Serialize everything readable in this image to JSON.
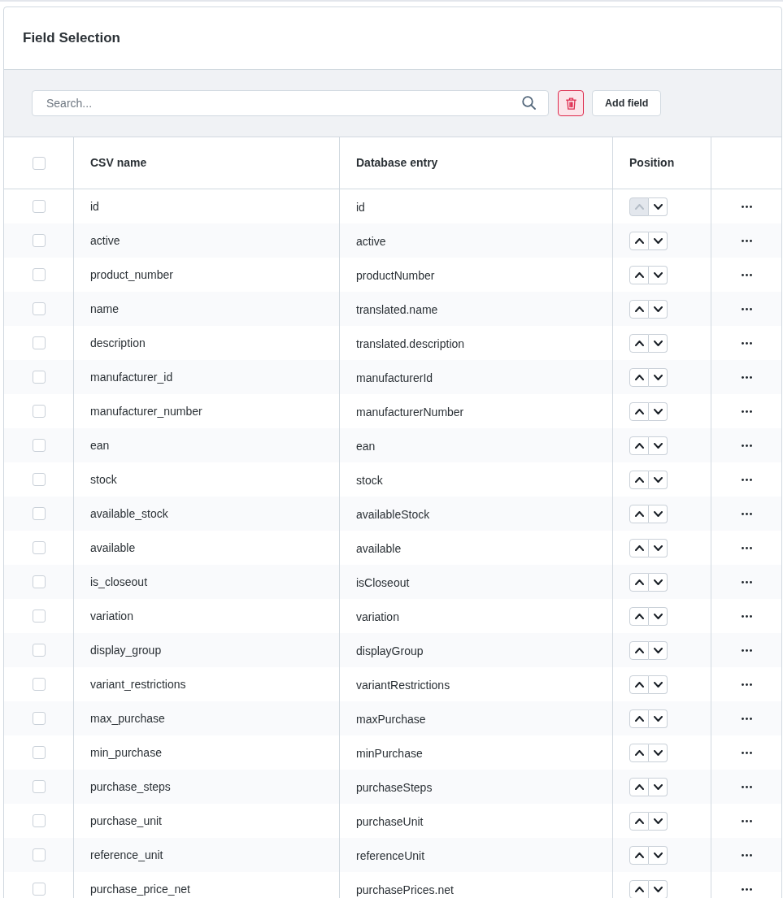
{
  "card": {
    "title": "Field Selection"
  },
  "toolbar": {
    "search": {
      "placeholder": "Search..."
    },
    "add_button": "Add field"
  },
  "table": {
    "select_all": {
      "checked": false
    },
    "columns": [
      "CSV name",
      "Database entry",
      "Position"
    ],
    "rows": [
      {
        "csv_name": "id",
        "database_entry": "id",
        "checked": false,
        "up_disabled": true
      },
      {
        "csv_name": "active",
        "database_entry": "active",
        "checked": false,
        "up_disabled": false
      },
      {
        "csv_name": "product_number",
        "database_entry": "productNumber",
        "checked": false,
        "up_disabled": false
      },
      {
        "csv_name": "name",
        "database_entry": "translated.name",
        "checked": false,
        "up_disabled": false
      },
      {
        "csv_name": "description",
        "database_entry": "translated.description",
        "checked": false,
        "up_disabled": false
      },
      {
        "csv_name": "manufacturer_id",
        "database_entry": "manufacturerId",
        "checked": false,
        "up_disabled": false
      },
      {
        "csv_name": "manufacturer_number",
        "database_entry": "manufacturerNumber",
        "checked": false,
        "up_disabled": false
      },
      {
        "csv_name": "ean",
        "database_entry": "ean",
        "checked": false,
        "up_disabled": false
      },
      {
        "csv_name": "stock",
        "database_entry": "stock",
        "checked": false,
        "up_disabled": false
      },
      {
        "csv_name": "available_stock",
        "database_entry": "availableStock",
        "checked": false,
        "up_disabled": false
      },
      {
        "csv_name": "available",
        "database_entry": "available",
        "checked": false,
        "up_disabled": false
      },
      {
        "csv_name": "is_closeout",
        "database_entry": "isCloseout",
        "checked": false,
        "up_disabled": false
      },
      {
        "csv_name": "variation",
        "database_entry": "variation",
        "checked": false,
        "up_disabled": false
      },
      {
        "csv_name": "display_group",
        "database_entry": "displayGroup",
        "checked": false,
        "up_disabled": false
      },
      {
        "csv_name": "variant_restrictions",
        "database_entry": "variantRestrictions",
        "checked": false,
        "up_disabled": false
      },
      {
        "csv_name": "max_purchase",
        "database_entry": "maxPurchase",
        "checked": false,
        "up_disabled": false
      },
      {
        "csv_name": "min_purchase",
        "database_entry": "minPurchase",
        "checked": false,
        "up_disabled": false
      },
      {
        "csv_name": "purchase_steps",
        "database_entry": "purchaseSteps",
        "checked": false,
        "up_disabled": false
      },
      {
        "csv_name": "purchase_unit",
        "database_entry": "purchaseUnit",
        "checked": false,
        "up_disabled": false
      },
      {
        "csv_name": "reference_unit",
        "database_entry": "referenceUnit",
        "checked": false,
        "up_disabled": false
      },
      {
        "csv_name": "purchase_price_net",
        "database_entry": "purchasePrices.net",
        "checked": false,
        "up_disabled": false
      }
    ]
  }
}
